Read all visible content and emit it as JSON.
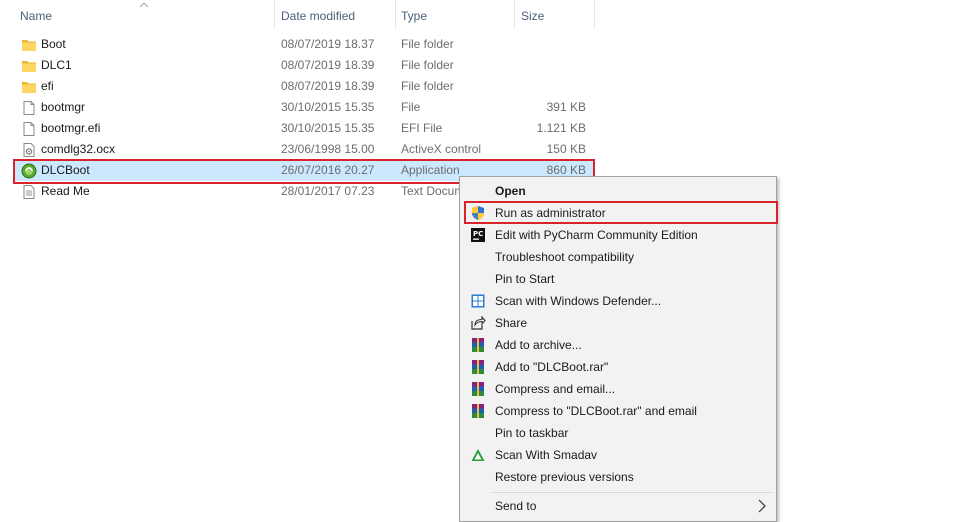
{
  "columns": {
    "name": "Name",
    "date": "Date modified",
    "type": "Type",
    "size": "Size"
  },
  "files": [
    {
      "name": "Boot",
      "date": "08/07/2019 18.37",
      "type": "File folder",
      "size": "",
      "icon": "folder-icon"
    },
    {
      "name": "DLC1",
      "date": "08/07/2019 18.39",
      "type": "File folder",
      "size": "",
      "icon": "folder-icon"
    },
    {
      "name": "efi",
      "date": "08/07/2019 18.39",
      "type": "File folder",
      "size": "",
      "icon": "folder-icon"
    },
    {
      "name": "bootmgr",
      "date": "30/10/2015 15.35",
      "type": "File",
      "size": "391 KB",
      "icon": "file-icon"
    },
    {
      "name": "bootmgr.efi",
      "date": "30/10/2015 15.35",
      "type": "EFI File",
      "size": "1.121 KB",
      "icon": "file-icon"
    },
    {
      "name": "comdlg32.ocx",
      "date": "23/06/1998 15.00",
      "type": "ActiveX control",
      "size": "150 KB",
      "icon": "activex-file-icon"
    },
    {
      "name": "DLCBoot",
      "date": "26/07/2016 20.27",
      "type": "Application",
      "size": "860 KB",
      "icon": "dlcboot-app-icon"
    },
    {
      "name": "Read Me",
      "date": "28/01/2017 07.23",
      "type": "Text Docum",
      "size": "",
      "icon": "text-document-icon"
    }
  ],
  "context_menu": {
    "items": [
      {
        "label": "Open",
        "icon": ""
      },
      {
        "label": "Run as administrator",
        "icon": "uac-shield-icon"
      },
      {
        "label": "Edit with PyCharm Community Edition",
        "icon": "pycharm-icon"
      },
      {
        "label": "Troubleshoot compatibility",
        "icon": ""
      },
      {
        "label": "Pin to Start",
        "icon": ""
      },
      {
        "label": "Scan with Windows Defender...",
        "icon": "windows-defender-icon"
      },
      {
        "label": "Share",
        "icon": "share-icon"
      },
      {
        "label": "Add to archive...",
        "icon": "winrar-icon"
      },
      {
        "label": "Add to \"DLCBoot.rar\"",
        "icon": "winrar-icon"
      },
      {
        "label": "Compress and email...",
        "icon": "winrar-icon"
      },
      {
        "label": "Compress to \"DLCBoot.rar\" and email",
        "icon": "winrar-icon"
      },
      {
        "label": "Pin to taskbar",
        "icon": ""
      },
      {
        "label": "Scan With Smadav",
        "icon": "smadav-icon"
      },
      {
        "label": "Restore previous versions",
        "icon": ""
      },
      {
        "label": "Send to",
        "icon": ""
      }
    ]
  },
  "colors": {
    "highlight_border": "#d8232a",
    "selection_bg": "#cce8ff",
    "folder": "#ffd561"
  }
}
